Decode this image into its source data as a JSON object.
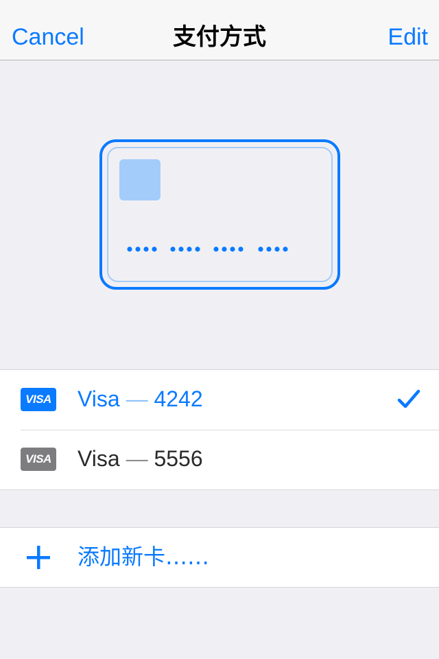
{
  "navbar": {
    "cancel_label": "Cancel",
    "title": "支付方式",
    "edit_label": "Edit"
  },
  "card_illustration": {
    "number_mask": "•••• •••• •••• ••••"
  },
  "cards": [
    {
      "brand": "VISA",
      "name": "Visa",
      "separator": "—",
      "last4": "4242",
      "selected": true
    },
    {
      "brand": "VISA",
      "name": "Visa",
      "separator": "—",
      "last4": "5556",
      "selected": false
    }
  ],
  "add_card": {
    "label": "添加新卡……",
    "icon": "plus-icon"
  },
  "icons": {
    "selected": "checkmark-icon"
  },
  "colors": {
    "accent": "#0a7aff",
    "chip": "#a3ccfa",
    "inactive_badge": "#7d7d7f",
    "background": "#f0f0f4"
  }
}
